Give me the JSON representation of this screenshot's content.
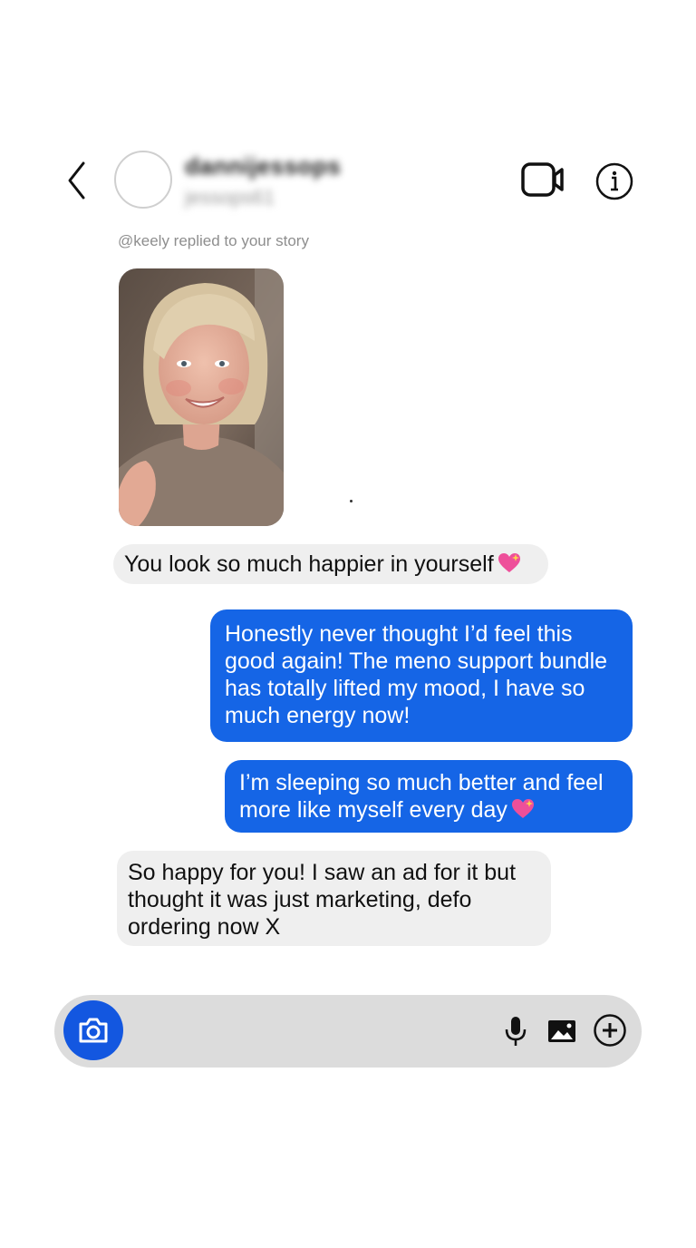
{
  "header": {
    "display_name": "dannijessops",
    "username": "jessops61"
  },
  "story": {
    "reply_label": "@keely replied to your story"
  },
  "messages": [
    {
      "direction": "incoming",
      "text": "You look so much happier in yourself",
      "emoji": "sparkling-heart"
    },
    {
      "direction": "outgoing",
      "text": "Honestly never thought I’d feel this good again! The meno support bundle has totally lifted my mood, I have so much energy now!"
    },
    {
      "direction": "outgoing",
      "text": "I’m sleeping so much better and feel more like myself every day",
      "emoji": "sparkling-heart"
    },
    {
      "direction": "incoming",
      "text": "So happy for you! I saw an ad for it but thought it was just marketing, defo ordering now X"
    }
  ],
  "composer": {
    "icons": [
      "camera-icon",
      "microphone-icon",
      "gallery-icon",
      "plus-circle-icon"
    ]
  },
  "colors": {
    "outgoing_bubble": "#1565e6",
    "incoming_bubble": "#efefef",
    "camera_button": "#1357e0",
    "composer_bg": "#dcdcdc"
  }
}
